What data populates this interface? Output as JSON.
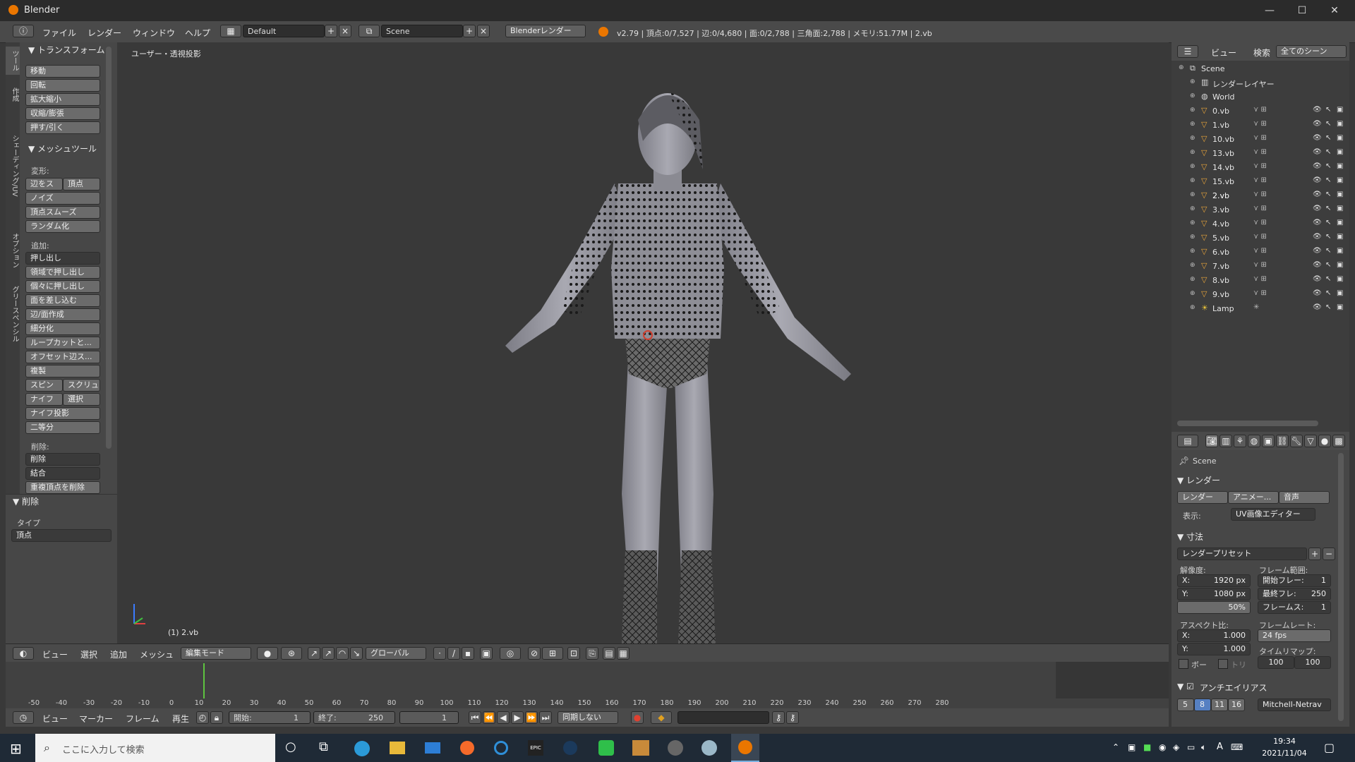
{
  "window": {
    "title": "Blender",
    "minimize": "—",
    "maximize": "☐",
    "close": "✕"
  },
  "infobar": {
    "menus": [
      "ファイル",
      "レンダー",
      "ウィンドウ",
      "ヘルプ"
    ],
    "layout": "Default",
    "scene": "Scene",
    "engine": "Blenderレンダー",
    "stats": "v2.79 | 頂点:0/7,527 | 辺:0/4,680 | 面:0/2,788 | 三角面:2,788 | メモリ:51.77M | 2.vb"
  },
  "tool_tabs": [
    "ツール",
    "作成",
    "シェーディング/UV",
    "オプション",
    "グリースペンシル"
  ],
  "tool_panel": {
    "transform_title": "▼ トランスフォーム",
    "transform_buttons": [
      "移動",
      "回転",
      "拡大縮小",
      "収縮/膨張",
      "押す/引く"
    ],
    "mesh_title": "▼ メッシュツール",
    "deform_label": "変形:",
    "deform_pair": [
      "辺をス",
      "頂点"
    ],
    "deform_buttons": [
      "ノイズ",
      "頂点スムーズ",
      "ランダム化"
    ],
    "add_label": "追加:",
    "extrude_dd": "押し出し",
    "add_buttons": [
      "領域で押し出し",
      "個々に押し出し",
      "面を差し込む",
      "辺/面作成",
      "細分化",
      "ループカットと...",
      "オフセット辺ス...",
      "複製"
    ],
    "spin_pair": [
      "スピン",
      "スクリュ"
    ],
    "knife_pair": [
      "ナイフ",
      "選択"
    ],
    "add_buttons2": [
      "ナイフ投影",
      "二等分"
    ],
    "delete_label": "削除:",
    "delete_dd": "削除",
    "merge_dd": "結合",
    "remove_doubles": "重複頂点を削除"
  },
  "operator_panel": {
    "title": "▼ 削除",
    "type_label": "タイプ",
    "type_value": "頂点"
  },
  "viewport": {
    "label": "ユーザー・透視投影",
    "object_label": "(1) 2.vb"
  },
  "viewport_header": {
    "menus": [
      "ビュー",
      "選択",
      "追加",
      "メッシュ"
    ],
    "mode": "編集モード",
    "orientation": "グローバル"
  },
  "timeline": {
    "ticks": [
      -50,
      -40,
      -30,
      -20,
      -10,
      0,
      10,
      20,
      30,
      40,
      50,
      60,
      70,
      80,
      90,
      100,
      110,
      120,
      130,
      140,
      150,
      160,
      170,
      180,
      190,
      200,
      210,
      220,
      230,
      240,
      250,
      260,
      270,
      280
    ],
    "current_frame": 1,
    "menus": [
      "ビュー",
      "マーカー",
      "フレーム",
      "再生"
    ],
    "start_label": "開始:",
    "start_value": "1",
    "end_label": "終了:",
    "end_value": "250",
    "frame_value": "1",
    "sync": "同期しない"
  },
  "outliner": {
    "menus": [
      "ビュー",
      "検索"
    ],
    "filter": "全てのシーン",
    "scene": "Scene",
    "render_layers": "レンダーレイヤー",
    "world": "World",
    "objects": [
      "0.vb",
      "1.vb",
      "10.vb",
      "13.vb",
      "14.vb",
      "15.vb",
      "2.vb",
      "3.vb",
      "4.vb",
      "5.vb",
      "6.vb",
      "7.vb",
      "8.vb",
      "9.vb"
    ],
    "lamp": "Lamp",
    "active_object": "2.vb"
  },
  "properties": {
    "scene": "Scene",
    "render_title": "▼ レンダー",
    "render_buttons": [
      "レンダー",
      "アニメー...",
      "音声"
    ],
    "display_label": "表示:",
    "display_value": "UV画像エディター",
    "dimensions_title": "▼ 寸法",
    "preset": "レンダープリセット",
    "resolution_label": "解像度:",
    "res_x": "X:",
    "res_x_value": "1920 px",
    "res_y": "Y:",
    "res_y_value": "1080 px",
    "res_pct": "50%",
    "frame_range_label": "フレーム範囲:",
    "frame_start": "開始フレー:",
    "frame_start_value": "1",
    "frame_end": "最終フレ:",
    "frame_end_value": "250",
    "frame_step": "フレームス:",
    "frame_step_value": "1",
    "aspect_label": "アスペクト比:",
    "aspect_x": "X:",
    "aspect_x_value": "1.000",
    "aspect_y": "Y:",
    "aspect_y_value": "1.000",
    "fps_label": "フレームレート:",
    "fps_value": "24 fps",
    "remap_label": "タイムリマップ:",
    "remap_old": "100",
    "remap_new": "100",
    "border_label": "ボー",
    "crop_label": "トリ",
    "aa_title": "アンチエイリアス",
    "aa_samples": [
      "5",
      "8",
      "11",
      "16"
    ],
    "aa_filter": "Mitchell-Netrav"
  },
  "taskbar": {
    "search_placeholder": "ここに入力して検索",
    "ime": "A",
    "time": "19:34",
    "date": "2021/11/04"
  }
}
